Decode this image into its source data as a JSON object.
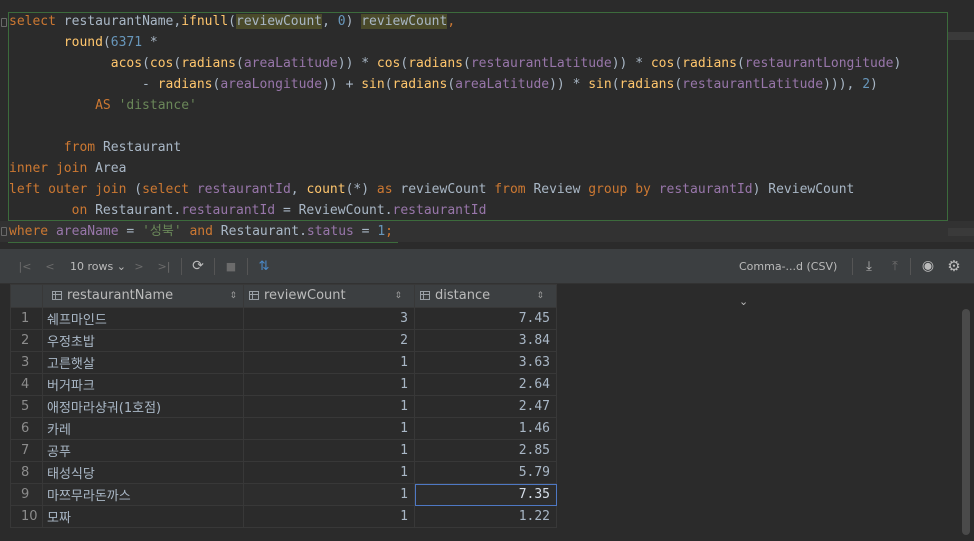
{
  "editor": {
    "lines": [
      {
        "tokens": [
          [
            "kw",
            "select "
          ],
          [
            "",
            "restaurantName,"
          ],
          [
            "fn",
            "ifnull"
          ],
          [
            "",
            "("
          ],
          [
            "hl",
            "reviewCount"
          ],
          [
            "",
            ", "
          ],
          [
            "num",
            "0"
          ],
          [
            "",
            ") "
          ],
          [
            "hl",
            "reviewCount"
          ],
          [
            "kw",
            ","
          ]
        ]
      },
      {
        "tokens": [
          [
            "",
            "       "
          ],
          [
            "fn",
            "round"
          ],
          [
            "",
            "("
          ],
          [
            "num",
            "6371"
          ],
          [
            "",
            " *"
          ]
        ]
      },
      {
        "tokens": [
          [
            "",
            "             "
          ],
          [
            "fn",
            "acos"
          ],
          [
            "",
            "("
          ],
          [
            "fn",
            "cos"
          ],
          [
            "",
            "("
          ],
          [
            "fn",
            "radians"
          ],
          [
            "",
            "("
          ],
          [
            "col",
            "areaLatitude"
          ],
          [
            "",
            "))"
          ],
          [
            "",
            " * "
          ],
          [
            "fn",
            "cos"
          ],
          [
            "",
            "("
          ],
          [
            "fn",
            "radians"
          ],
          [
            "",
            "("
          ],
          [
            "col",
            "restaurantLatitude"
          ],
          [
            "",
            "))"
          ],
          [
            "",
            " * "
          ],
          [
            "fn",
            "cos"
          ],
          [
            "",
            "("
          ],
          [
            "fn",
            "radians"
          ],
          [
            "",
            "("
          ],
          [
            "col",
            "restaurantLongitude"
          ],
          [
            "",
            ")"
          ]
        ]
      },
      {
        "tokens": [
          [
            "",
            "                 - "
          ],
          [
            "fn",
            "radians"
          ],
          [
            "",
            "("
          ],
          [
            "col",
            "areaLongitude"
          ],
          [
            "",
            "))"
          ],
          [
            "",
            " + "
          ],
          [
            "fn",
            "sin"
          ],
          [
            "",
            "("
          ],
          [
            "fn",
            "radians"
          ],
          [
            "",
            "("
          ],
          [
            "col",
            "areaLatitude"
          ],
          [
            "",
            "))"
          ],
          [
            "",
            " * "
          ],
          [
            "fn",
            "sin"
          ],
          [
            "",
            "("
          ],
          [
            "fn",
            "radians"
          ],
          [
            "",
            "("
          ],
          [
            "col",
            "restaurantLatitude"
          ],
          [
            "",
            ")))"
          ],
          [
            "",
            ", "
          ],
          [
            "num",
            "2"
          ],
          [
            "",
            ")"
          ]
        ]
      },
      {
        "tokens": [
          [
            "",
            "           "
          ],
          [
            "kw",
            "AS "
          ],
          [
            "str",
            "'distance'"
          ]
        ]
      },
      {
        "tokens": []
      },
      {
        "tokens": [
          [
            "",
            "       "
          ],
          [
            "kw",
            "from "
          ],
          [
            "",
            "Restaurant"
          ]
        ]
      },
      {
        "tokens": [
          [
            "kw",
            "inner join "
          ],
          [
            "",
            "Area"
          ]
        ]
      },
      {
        "tokens": [
          [
            "kw",
            "left outer join "
          ],
          [
            "",
            "("
          ],
          [
            "kw",
            "select "
          ],
          [
            "col",
            "restaurantId"
          ],
          [
            "",
            ", "
          ],
          [
            "fn",
            "count"
          ],
          [
            "",
            "(*) "
          ],
          [
            "kw",
            "as "
          ],
          [
            "",
            "reviewCount "
          ],
          [
            "kw",
            "from "
          ],
          [
            "",
            "Review "
          ],
          [
            "kw",
            "group by "
          ],
          [
            "col",
            "restaurantId"
          ],
          [
            "",
            ") ReviewCount"
          ]
        ]
      },
      {
        "tokens": [
          [
            "",
            "        "
          ],
          [
            "kw",
            "on "
          ],
          [
            "",
            "Restaurant."
          ],
          [
            "col",
            "restaurantId"
          ],
          [
            "",
            " = ReviewCount."
          ],
          [
            "col",
            "restaurantId"
          ]
        ]
      },
      {
        "tokens": [
          [
            "kw",
            "where "
          ],
          [
            "col",
            "areaName"
          ],
          [
            "",
            " = "
          ],
          [
            "str",
            "'성북'"
          ],
          [
            "",
            " "
          ],
          [
            "kw",
            "and "
          ],
          [
            "",
            "Restaurant."
          ],
          [
            "col",
            "status"
          ],
          [
            "",
            " = "
          ],
          [
            "num",
            "1"
          ],
          [
            "kw",
            ";"
          ]
        ]
      }
    ]
  },
  "toolbar": {
    "rows_label": "10 rows",
    "format_label": "Comma-...d (CSV)"
  },
  "table": {
    "columns": [
      "restaurantName",
      "reviewCount",
      "distance"
    ],
    "rows": [
      [
        "1",
        "쉐프마인드",
        "3",
        "7.45"
      ],
      [
        "2",
        "우정초밥",
        "2",
        "3.84"
      ],
      [
        "3",
        "고른햇살",
        "1",
        "3.63"
      ],
      [
        "4",
        "버거파크",
        "1",
        "2.64"
      ],
      [
        "5",
        "애정마라샹궈(1호점)",
        "1",
        "2.47"
      ],
      [
        "6",
        "카레",
        "1",
        "1.46"
      ],
      [
        "7",
        "공푸",
        "1",
        "2.85"
      ],
      [
        "8",
        "태성식당",
        "1",
        "5.79"
      ],
      [
        "9",
        "마쯔무라돈까스",
        "1",
        "7.35"
      ],
      [
        "10",
        "모짜",
        "1",
        "1.22"
      ]
    ],
    "selected": {
      "row": 9,
      "col": 3
    }
  }
}
